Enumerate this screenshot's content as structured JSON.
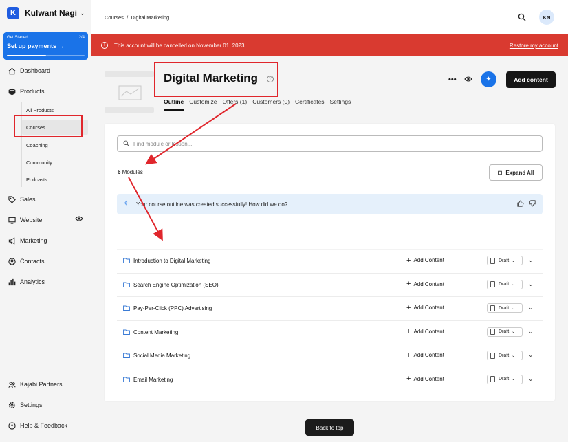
{
  "sidebar": {
    "brand_name": "Kulwant Nagi...",
    "setup": {
      "label": "Get Started",
      "progress_text": "2/4",
      "progress_fraction": 0.5,
      "title": "Set up payments"
    },
    "nav": [
      {
        "key": "dashboard",
        "label": "Dashboard",
        "icon": "home-icon"
      },
      {
        "key": "products",
        "label": "Products",
        "icon": "box-icon"
      },
      {
        "key": "sales",
        "label": "Sales",
        "icon": "tag-icon"
      },
      {
        "key": "website",
        "label": "Website",
        "icon": "monitor-icon"
      },
      {
        "key": "marketing",
        "label": "Marketing",
        "icon": "megaphone-icon"
      },
      {
        "key": "contacts",
        "label": "Contacts",
        "icon": "user-circle-icon"
      },
      {
        "key": "analytics",
        "label": "Analytics",
        "icon": "bar-chart-icon"
      }
    ],
    "products_sub": [
      "All Products",
      "Courses",
      "Coaching",
      "Community",
      "Podcasts"
    ],
    "footer": [
      {
        "label": "Kajabi Partners",
        "icon": "people-icon"
      },
      {
        "label": "Settings",
        "icon": "gear-icon"
      },
      {
        "label": "Help & Feedback",
        "icon": "help-icon"
      }
    ]
  },
  "topbar": {
    "breadcrumb": "Courses  /  Digital Marketing",
    "avatar": "KN"
  },
  "banner": {
    "text": "This account will be cancelled on November 01, 2023",
    "link": "Restore my account",
    "color": "#d93a30"
  },
  "header": {
    "title": "Digital Marketing",
    "tabs": [
      "Outline",
      "Customize",
      "Offers (1)",
      "Customers (0)",
      "Certificates",
      "Settings"
    ],
    "more": "•••",
    "add_content": "Add content"
  },
  "outline": {
    "search_placeholder": "Find module or lesson...",
    "module_count": "6",
    "module_label": " Modules",
    "expand_all": "Expand All",
    "feedback_text": "Your course outline was created successfully! How did we do?",
    "modules": [
      {
        "name": "Introduction to Digital Marketing",
        "add": "Add Content",
        "status": "Draft"
      },
      {
        "name": "Search Engine Optimization (SEO)",
        "add": "Add Content",
        "status": "Draft"
      },
      {
        "name": "Pay-Per-Click (PPC) Advertising",
        "add": "Add Content",
        "status": "Draft"
      },
      {
        "name": "Content Marketing",
        "add": "Add Content",
        "status": "Draft"
      },
      {
        "name": "Social Media Marketing",
        "add": "Add Content",
        "status": "Draft"
      },
      {
        "name": "Email Marketing",
        "add": "Add Content",
        "status": "Draft"
      }
    ],
    "back_to_top": "Back to top"
  },
  "colors": {
    "accent": "#1a73e8",
    "annotation": "#e0262c"
  }
}
